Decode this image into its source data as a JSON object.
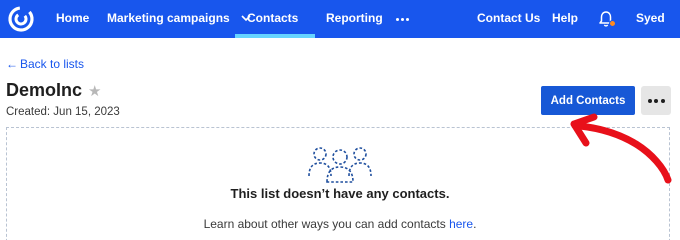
{
  "nav": {
    "brand_icon": "constant-contact-logo-icon",
    "items": [
      {
        "label": "Home"
      },
      {
        "label": "Marketing campaigns"
      },
      {
        "label": "Contacts"
      },
      {
        "label": "Reporting"
      }
    ],
    "active_item": "Contacts",
    "more_icon": "ellipsis-icon",
    "right": {
      "contact_us": "Contact Us",
      "help": "Help",
      "notifications_icon": "bell-icon",
      "user_name": "Syed"
    },
    "colors": {
      "background": "#1856ed",
      "active_underline": "#66d4ff",
      "badge": "#ff8a1f"
    }
  },
  "page": {
    "back_link": "Back to lists",
    "list_name": "DemoInc",
    "favorite_icon": "star-icon",
    "created": "Created: Jun 15, 2023",
    "add_contacts_label": "Add Contacts",
    "more_actions_icon": "ellipsis-icon"
  },
  "empty_state": {
    "icon": "people-group-icon",
    "title": "This list doesn’t have any contacts.",
    "learn_prefix": "Learn about other ways you can add contacts ",
    "learn_link": "here",
    "learn_suffix": "."
  },
  "annotation": {
    "icon": "red-arrow-icon",
    "color": "#e8101a"
  }
}
